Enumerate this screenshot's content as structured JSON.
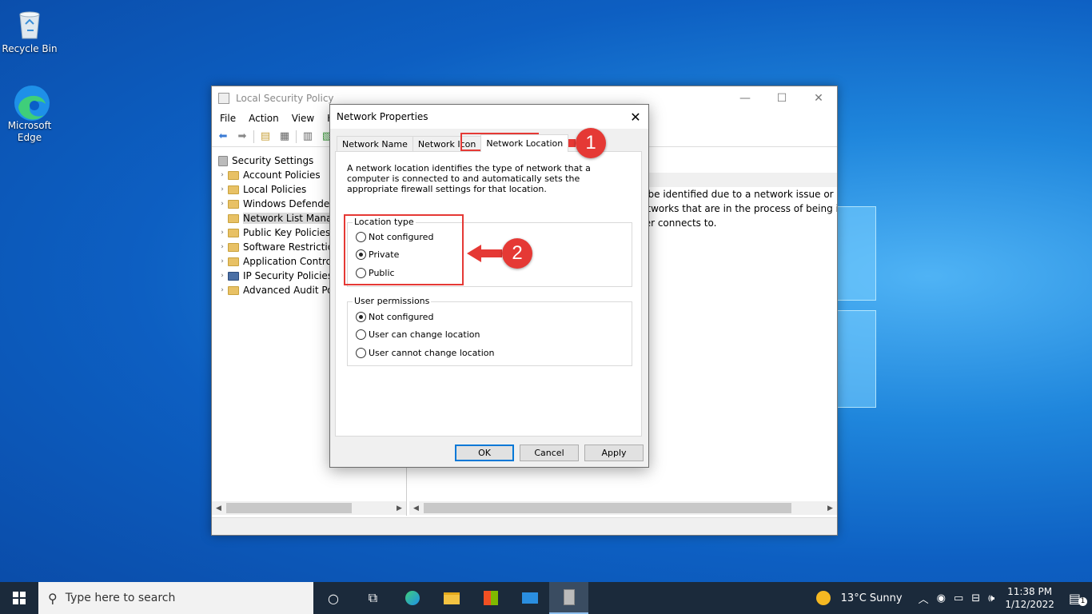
{
  "desktop": {
    "icons": [
      {
        "label": "Recycle Bin"
      },
      {
        "label": "Microsoft Edge"
      }
    ]
  },
  "mmc": {
    "title": "Local Security Policy",
    "menu": [
      "File",
      "Action",
      "View",
      "He"
    ],
    "tree": [
      {
        "label": "Security Settings",
        "expander": ""
      },
      {
        "label": "Account Policies",
        "expander": "›"
      },
      {
        "label": "Local Policies",
        "expander": "›"
      },
      {
        "label": "Windows Defender",
        "expander": "›"
      },
      {
        "label": "Network List Manag",
        "expander": ""
      },
      {
        "label": "Public Key Policies",
        "expander": "›"
      },
      {
        "label": "Software Restriction",
        "expander": "›"
      },
      {
        "label": "Application Control",
        "expander": "›"
      },
      {
        "label": "IP Security Policies o",
        "expander": "›"
      },
      {
        "label": "Advanced Audit Pol",
        "expander": "›"
      }
    ],
    "right_lines": [
      "t be identified due to a network issue or lack o",
      "etworks that are in the process of being identi",
      "ter connects to."
    ]
  },
  "dialog": {
    "title": "Network Properties",
    "close_glyph": "✕",
    "tabs": [
      "Network Name",
      "Network Icon",
      "Network Location"
    ],
    "description": "A network location identifies the type of network that a computer is connected to and automatically sets the appropriate firewall settings for that location.",
    "location_type": {
      "title": "Location type",
      "options": [
        {
          "label": "Not configured",
          "checked": false
        },
        {
          "label": "Private",
          "checked": true
        },
        {
          "label": "Public",
          "checked": false
        }
      ]
    },
    "user_permissions": {
      "title": "User permissions",
      "options": [
        {
          "label": "Not configured",
          "checked": true
        },
        {
          "label": "User can change location",
          "checked": false
        },
        {
          "label": "User cannot change location",
          "checked": false
        }
      ]
    },
    "buttons": {
      "ok": "OK",
      "cancel": "Cancel",
      "apply": "Apply"
    }
  },
  "annotations": {
    "step1": "1",
    "step2": "2",
    "color": "#e53935"
  },
  "taskbar": {
    "search_placeholder": "Type here to search",
    "weather": "13°C  Sunny",
    "time": "11:38 PM",
    "date": "1/12/2022",
    "notification_count": "1"
  }
}
